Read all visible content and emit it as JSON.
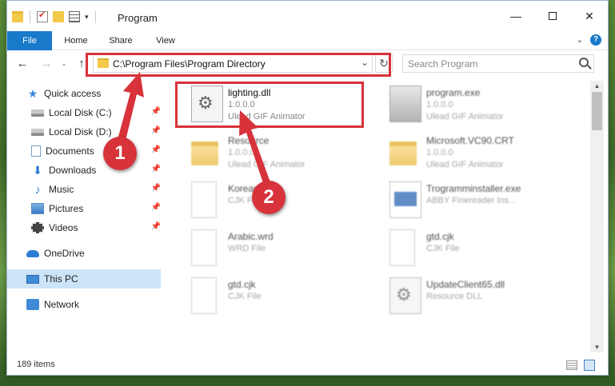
{
  "window": {
    "title": "Program",
    "qat_caret": "▾"
  },
  "ribbon": {
    "tabs": [
      "File",
      "Home",
      "Share",
      "View"
    ],
    "chevron": "⌄",
    "help": "?"
  },
  "controls": {
    "minimize": "—",
    "close": "✕"
  },
  "nav": {
    "back": "←",
    "forward": "→",
    "recent": "⌄",
    "up": "↑",
    "address": "C:\\Program Files\\Program Directory",
    "address_dropdown": "⌄",
    "refresh": "↻",
    "search_placeholder": "Search Program"
  },
  "sidebar": {
    "pin": "📌",
    "items": [
      {
        "label": "Quick access",
        "icon": "star-icon",
        "glyph": "★"
      },
      {
        "label": "Local Disk (C:)",
        "icon": "disk-icon"
      },
      {
        "label": "Local Disk (D:)",
        "icon": "disk-icon"
      },
      {
        "label": "Documents",
        "icon": "documents-icon"
      },
      {
        "label": "Downloads",
        "icon": "downloads-icon",
        "glyph": "⬇"
      },
      {
        "label": "Music",
        "icon": "music-icon",
        "glyph": "♪"
      },
      {
        "label": "Pictures",
        "icon": "pictures-icon"
      },
      {
        "label": "Videos",
        "icon": "videos-icon"
      },
      {
        "label": "OneDrive",
        "icon": "onedrive-icon"
      },
      {
        "label": "This PC",
        "icon": "this-pc-icon",
        "selected": true
      },
      {
        "label": "Network",
        "icon": "network-icon"
      }
    ]
  },
  "files": [
    {
      "name": "lighting.dll",
      "line1": "1.0.0.0",
      "line2": "Ulead GIF Animator",
      "icon": "dll-gear-icon"
    },
    {
      "name": "program.exe",
      "line1": "1.0.0.0",
      "line2": "Ulead GIF Animator",
      "icon": "exe-icon"
    },
    {
      "name": "Resource",
      "line1": "1.0.0.0",
      "line2": "Ulead GIF Animator",
      "icon": "folder-icon"
    },
    {
      "name": "Microsoft.VC90.CRT",
      "line1": "1.0.0.0",
      "line2": "Ulead GIF Animator",
      "icon": "folder-icon"
    },
    {
      "name": "Korean",
      "line1": "CJK File",
      "line2": "",
      "icon": "file-icon"
    },
    {
      "name": "Trogramminstaller.exe",
      "line1": "ABBY Finereader Ins...",
      "line2": "",
      "icon": "installer-icon"
    },
    {
      "name": "Arabic.wrd",
      "line1": "WRD File",
      "line2": "",
      "icon": "file-icon"
    },
    {
      "name": "gtd.cjk",
      "line1": "CJK File",
      "line2": "",
      "icon": "file-icon"
    },
    {
      "name": "gtd.cjk",
      "line1": "CJK File",
      "line2": "",
      "icon": "file-icon"
    },
    {
      "name": "UpdateClient65.dll",
      "line1": "Resource DLL",
      "line2": "",
      "icon": "dll-gear-icon"
    }
  ],
  "status": {
    "count": "189 items"
  },
  "annotations": {
    "color": "#d8323a",
    "callouts": [
      "1",
      "2"
    ]
  },
  "scrollbar": {
    "up": "▲",
    "down": "▼"
  }
}
